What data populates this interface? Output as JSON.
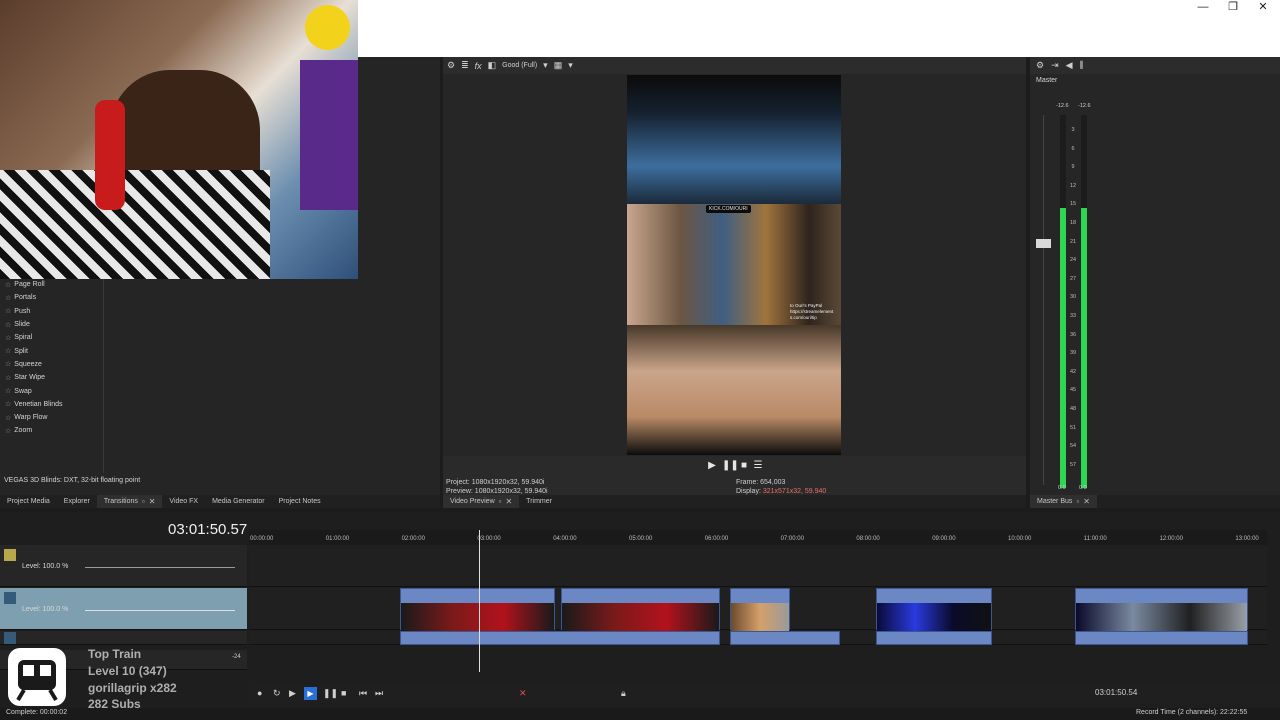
{
  "window_controls": [
    "—",
    "❐",
    "✕"
  ],
  "transitions": {
    "items": [
      "Page Roll",
      "Portals",
      "Push",
      "Slide",
      "Spiral",
      "Split",
      "Squeeze",
      "Star Wipe",
      "Swap",
      "Venetian Blinds",
      "Warp Flow",
      "Zoom"
    ],
    "plugin_description": "VEGAS 3D Blinds: DXT, 32-bit floating point"
  },
  "left_tabs": [
    {
      "label": "Project Media",
      "active": false,
      "closable": false
    },
    {
      "label": "Explorer",
      "active": false,
      "closable": false
    },
    {
      "label": "Transitions",
      "active": true,
      "closable": true
    },
    {
      "label": "Video FX",
      "active": false,
      "closable": false
    },
    {
      "label": "Media Generator",
      "active": false,
      "closable": false
    },
    {
      "label": "Project Notes",
      "active": false,
      "closable": false
    }
  ],
  "preview": {
    "quality": "Good (Full)",
    "kick_badge": "KICK.COM/OURI",
    "overlay_lines": [
      "to Ouri's PayPal",
      "https://streamelement",
      "s.com/ouri/tip"
    ],
    "project_label": "Project:",
    "project_value": "1080x1920x32, 59.940i",
    "preview_label": "Preview:",
    "preview_value": "1080x1920x32, 59.940i",
    "frame_label": "Frame:",
    "frame_value": "654,003",
    "display_label": "Display:",
    "display_value": "321x571x32, 59.940",
    "tabs": [
      {
        "label": "Video Preview",
        "closable": true
      },
      {
        "label": "Trimmer",
        "closable": false
      }
    ]
  },
  "mixer": {
    "master_label": "Master",
    "peak_left": "-12.6",
    "peak_right": "-12.6",
    "scale": [
      "3",
      "6",
      "9",
      "12",
      "15",
      "18",
      "21",
      "24",
      "27",
      "30",
      "33",
      "36",
      "39",
      "42",
      "45",
      "48",
      "51",
      "54",
      "57"
    ],
    "bottom_left": "0.0",
    "bottom_right": "0.0",
    "tab_label": "Master Bus",
    "meter_left_level": 0.75,
    "meter_right_level": 0.75
  },
  "timeline": {
    "time_display": "03:01:50.57",
    "ruler": [
      "00:00:00",
      "01:00:00",
      "02:00:00",
      "03:00:00",
      "04:00:00",
      "05:00:00",
      "06:00:00",
      "07:00:00",
      "08:00:00",
      "09:00:00",
      "10:00:00",
      "11:00:00",
      "12:00:00",
      "13:00:00"
    ],
    "tracks": [
      {
        "level": "Level: 100.0 %"
      },
      {
        "level": "Level: 100.0 %"
      }
    ],
    "master_level": "-24",
    "cursor_time": "03:01:50.54",
    "record_time": "Record Time (2 channels): 22:22:55",
    "status": "Complete: 00:00:02"
  },
  "stream_overlay": {
    "line1": "Top Train",
    "line2": "Level 10 (347)",
    "line3": "gorillagrip x282",
    "line4": "282 Subs"
  }
}
